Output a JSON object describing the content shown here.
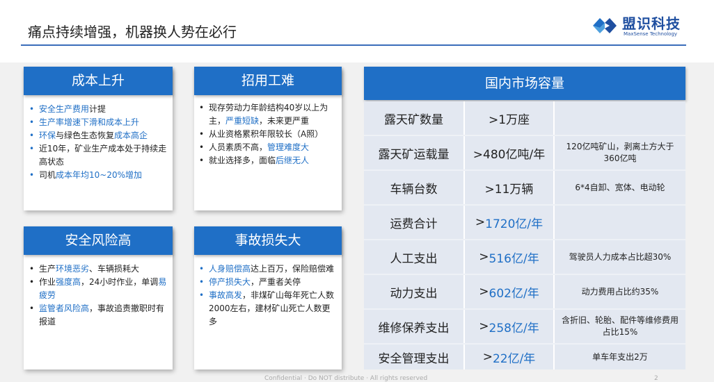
{
  "header": {
    "title": "痛点持续增强，机器换人势在必行",
    "logo_cn": "盟识科技",
    "logo_en": "MaxSense Technology"
  },
  "panels": {
    "cost": {
      "title": "成本上升",
      "items": [
        {
          "a": "安全生产费用",
          "b": "计提"
        },
        {
          "a": "生产率增速下滑和成本上升"
        },
        {
          "a": "环保",
          "b": "与绿色生态恢复",
          "c": "成本高企"
        },
        {
          "a": "近10年，矿业生产成本处于持续走高状态"
        },
        {
          "a": "司机",
          "b": "成本年均10~20%增加"
        }
      ]
    },
    "labor": {
      "title": "招用工难",
      "items": [
        {
          "a": "现存劳动力年龄结构40岁以上为主，",
          "b": "严重短缺",
          "c": "，未来更严重"
        },
        {
          "a": "从业资格累积年限较长（A照）"
        },
        {
          "a": "人员素质不高，",
          "b": "管理难度大"
        },
        {
          "a": "就业选择多，面临",
          "b": "后继无人"
        }
      ]
    },
    "risk": {
      "title": "安全风险高",
      "items": [
        {
          "a": "生产",
          "b": "环境恶劣",
          "c": "、车辆损耗大"
        },
        {
          "a": "作业",
          "b": "强度高",
          "c": "，24小时作业，单调",
          "d": "易疲劳"
        },
        {
          "a": "监管者风险高",
          "b": "，事故追责撤职时有报道"
        }
      ]
    },
    "loss": {
      "title": "事故损失大",
      "items": [
        {
          "a": "人身赔偿高",
          "b": "达上百万，保险赔偿难"
        },
        {
          "a": "停产损失大",
          "b": "，严重者关停"
        },
        {
          "a": "事故高发",
          "b": "，非煤矿山每年死亡人数 2000左右，建材矿山死亡人数更多"
        }
      ]
    }
  },
  "market": {
    "title": "国内市场容量",
    "rows": [
      {
        "label": "露天矿数量",
        "value": ">1万座",
        "note": ""
      },
      {
        "label": "露天矿运载量",
        "value": ">480亿吨/年",
        "note": "120亿吨矿山，剥离土方大于360亿吨"
      },
      {
        "label": "车辆台数",
        "value": ">11万辆",
        "note": "6*4自卸、宽体、电动轮"
      },
      {
        "label": "运费合计",
        "value_prefix": ">",
        "value_hl": "1720亿/年",
        "note": ""
      },
      {
        "label": "人工支出",
        "value_prefix": ">",
        "value_hl": "516亿/年",
        "note": "驾驶员人力成本占比超30%"
      },
      {
        "label": "动力支出",
        "value_prefix": ">",
        "value_hl": "602亿/年",
        "note": "动力费用占比约35%"
      },
      {
        "label": "维修保养支出",
        "value_prefix": ">",
        "value_hl": "258亿/年",
        "note": "含折旧、轮胎、配件等维修费用占比15%"
      },
      {
        "label": "安全管理支出",
        "value_prefix": ">",
        "value_hl": "22亿/年",
        "note": "单车年支出2万"
      }
    ]
  },
  "footer": {
    "text": "Confidential · Do NOT distribute · All rights reserved",
    "page": "2"
  },
  "colors": {
    "accent": "#1f6fc6",
    "logo": "#1f4fa0"
  }
}
